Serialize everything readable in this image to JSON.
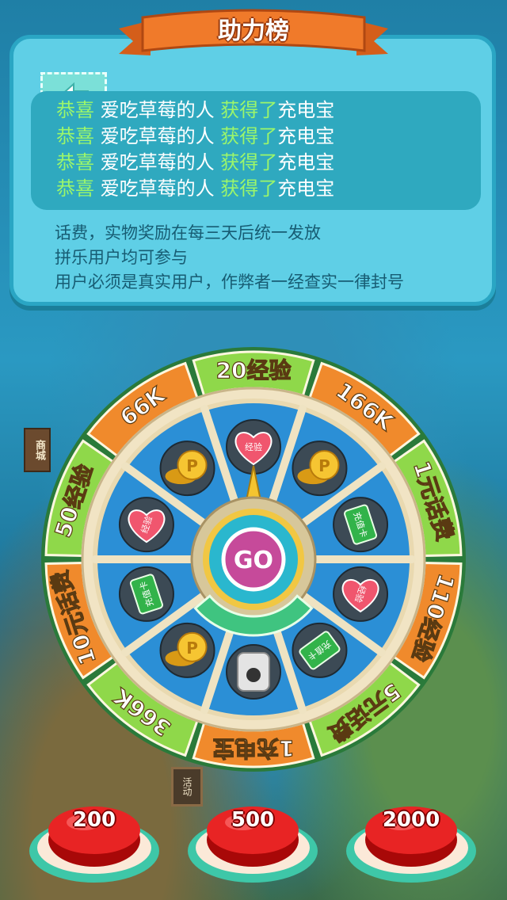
{
  "header": {
    "title": "助力榜",
    "back_icon": "arrow-left-icon"
  },
  "winners": [
    {
      "prefix": "恭喜",
      "name": "爱吃草莓的人",
      "action": "获得了",
      "prize": "充电宝"
    },
    {
      "prefix": "恭喜",
      "name": "爱吃草莓的人",
      "action": "获得了",
      "prize": "充电宝"
    },
    {
      "prefix": "恭喜",
      "name": "爱吃草莓的人",
      "action": "获得了",
      "prize": "充电宝"
    },
    {
      "prefix": "恭喜",
      "name": "爱吃草莓的人",
      "action": "获得了",
      "prize": "充电宝"
    }
  ],
  "rules": [
    "话费，实物奖励在每三天后统一发放",
    "拼乐用户均可参与",
    "用户必须是真实用户，作弊者一经查实一律封号"
  ],
  "wheel": {
    "center_label": "GO",
    "segments": [
      {
        "label": "20经验",
        "color": "#8fd84a",
        "icon": "heart-icon",
        "icon_text": "经验"
      },
      {
        "label": "166K",
        "color": "#f08a2c",
        "icon": "gold-coins-icon",
        "icon_text": ""
      },
      {
        "label": "1元话费",
        "color": "#8fd84a",
        "icon": "phone-card-icon",
        "icon_text": "充值卡"
      },
      {
        "label": "110经验",
        "color": "#f08a2c",
        "icon": "heart-icon",
        "icon_text": "经验"
      },
      {
        "label": "5元话费",
        "color": "#8fd84a",
        "icon": "phone-card-icon",
        "icon_text": "充值卡"
      },
      {
        "label": "1充电宝",
        "color": "#f08a2c",
        "icon": "power-bank-icon",
        "icon_text": ""
      },
      {
        "label": "366K",
        "color": "#8fd84a",
        "icon": "gold-coins-icon",
        "icon_text": ""
      },
      {
        "label": "10元话费",
        "color": "#f08a2c",
        "icon": "phone-card-icon",
        "icon_text": "充值卡"
      },
      {
        "label": "50经验",
        "color": "#8fd84a",
        "icon": "heart-icon",
        "icon_text": "经验"
      },
      {
        "label": "66K",
        "color": "#f08a2c",
        "icon": "gold-coin-p-icon",
        "icon_text": ""
      }
    ]
  },
  "buttons": [
    {
      "label": "200"
    },
    {
      "label": "500"
    },
    {
      "label": "2000"
    }
  ],
  "signs": {
    "shop": "商城",
    "activity": "活动"
  },
  "colors": {
    "panel": "#5fcfe6",
    "winner_highlight": "#9cf66a",
    "ribbon": "#f07a2a",
    "button_red": "#e01e1e"
  }
}
